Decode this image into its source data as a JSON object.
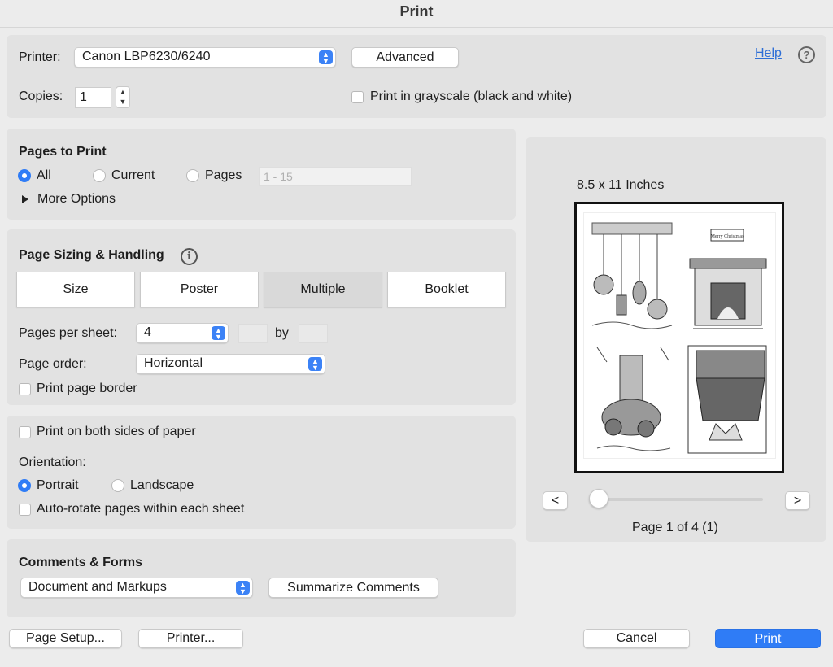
{
  "window": {
    "title": "Print"
  },
  "printer": {
    "label": "Printer:",
    "selected": "Canon LBP6230/6240",
    "advanced_button": "Advanced",
    "help_link": "Help",
    "help_icon": "question-circle-icon",
    "copies_label": "Copies:",
    "copies_value": "1",
    "grayscale_label": "Print in grayscale (black and white)",
    "grayscale_checked": false
  },
  "pages_to_print": {
    "heading": "Pages to Print",
    "options": [
      {
        "label": "All",
        "selected": true
      },
      {
        "label": "Current",
        "selected": false
      },
      {
        "label": "Pages",
        "selected": false
      }
    ],
    "range_placeholder": "1 - 15",
    "more_options": "More Options"
  },
  "sizing": {
    "heading": "Page Sizing & Handling",
    "info_icon": "info-icon",
    "modes": [
      {
        "label": "Size",
        "selected": false
      },
      {
        "label": "Poster",
        "selected": false
      },
      {
        "label": "Multiple",
        "selected": true
      },
      {
        "label": "Booklet",
        "selected": false
      }
    ],
    "pages_per_sheet_label": "Pages per sheet:",
    "pages_per_sheet_value": "4",
    "by_label": "by",
    "page_order_label": "Page order:",
    "page_order_value": "Horizontal",
    "border_label": "Print page border",
    "border_checked": false
  },
  "layout": {
    "both_sides_label": "Print on both sides of paper",
    "orientation_label": "Orientation:",
    "portrait_label": "Portrait",
    "landscape_label": "Landscape",
    "portrait_selected": true,
    "autorotate_label": "Auto-rotate pages within each sheet"
  },
  "comments": {
    "heading": "Comments & Forms",
    "selected": "Document and Markups",
    "summarize_button": "Summarize Comments"
  },
  "preview": {
    "size_label": "8.5 x 11 Inches",
    "prev_button": "<",
    "next_button": ">",
    "page_status": "Page 1 of 4 (1)",
    "thumbnails": [
      {
        "icon": "ornaments-illustration"
      },
      {
        "icon": "fireplace-illustration",
        "sign_text": "Merry Christmas"
      },
      {
        "icon": "candle-illustration"
      },
      {
        "icon": "stocking-illustration"
      }
    ]
  },
  "footer": {
    "page_setup": "Page Setup...",
    "printer": "Printer...",
    "cancel": "Cancel",
    "print": "Print"
  },
  "colors": {
    "accent": "#2f7cf6",
    "panel": "#e2e2e2",
    "background": "#ececec"
  }
}
